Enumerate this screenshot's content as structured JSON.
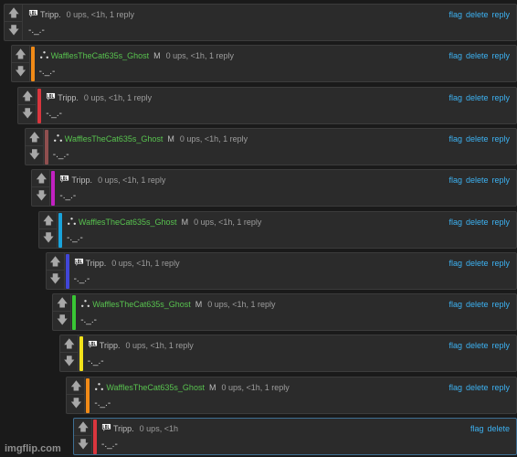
{
  "actions": {
    "flag": "flag",
    "delete": "delete",
    "reply": "reply"
  },
  "vote_icons": {
    "up": "arrow-up-icon",
    "down": "arrow-down-icon"
  },
  "colors": {
    "link": "#3db2f2",
    "green_user": "#58c34f"
  },
  "comments": [
    {
      "user": "Tripp.",
      "badge": "",
      "meta": "0 ups, <1h, 1 reply",
      "text": "-._.-",
      "bar_color": "",
      "avatar": "lol-icon",
      "actions": [
        "flag",
        "delete",
        "reply"
      ]
    },
    {
      "user": "WafflesTheCat635s_Ghost",
      "badge": "M",
      "meta": "0 ups, <1h, 1 reply",
      "text": "-._.-",
      "bar_color": "#f08a17",
      "avatar": "three-dots-icon",
      "actions": [
        "flag",
        "delete",
        "reply"
      ]
    },
    {
      "user": "Tripp.",
      "badge": "",
      "meta": "0 ups, <1h, 1 reply",
      "text": "-._.-",
      "bar_color": "#d9363e",
      "avatar": "lol-icon",
      "actions": [
        "flag",
        "delete",
        "reply"
      ]
    },
    {
      "user": "WafflesTheCat635s_Ghost",
      "badge": "M",
      "meta": "0 ups, <1h, 1 reply",
      "text": "-._.-",
      "bar_color": "#8f4f4f",
      "avatar": "three-dots-icon",
      "actions": [
        "flag",
        "delete",
        "reply"
      ]
    },
    {
      "user": "Tripp.",
      "badge": "",
      "meta": "0 ups, <1h, 1 reply",
      "text": "-._.-",
      "bar_color": "#c221c2",
      "avatar": "lol-icon",
      "actions": [
        "flag",
        "delete",
        "reply"
      ]
    },
    {
      "user": "WafflesTheCat635s_Ghost",
      "badge": "M",
      "meta": "0 ups, <1h, 1 reply",
      "text": "-._.-",
      "bar_color": "#19a3db",
      "avatar": "three-dots-icon",
      "actions": [
        "flag",
        "delete",
        "reply"
      ]
    },
    {
      "user": "Tripp.",
      "badge": "",
      "meta": "0 ups, <1h, 1 reply",
      "text": "-._.-",
      "bar_color": "#4146d8",
      "avatar": "lol-icon",
      "actions": [
        "flag",
        "delete",
        "reply"
      ]
    },
    {
      "user": "WafflesTheCat635s_Ghost",
      "badge": "M",
      "meta": "0 ups, <1h, 1 reply",
      "text": "-._.-",
      "bar_color": "#39c735",
      "avatar": "three-dots-icon",
      "actions": [
        "flag",
        "delete",
        "reply"
      ]
    },
    {
      "user": "Tripp.",
      "badge": "",
      "meta": "0 ups, <1h, 1 reply",
      "text": "-._.-",
      "bar_color": "#f2e21a",
      "avatar": "lol-icon",
      "actions": [
        "flag",
        "delete",
        "reply"
      ]
    },
    {
      "user": "WafflesTheCat635s_Ghost",
      "badge": "M",
      "meta": "0 ups, <1h, 1 reply",
      "text": "-._.-",
      "bar_color": "#f08a17",
      "avatar": "three-dots-icon",
      "actions": [
        "flag",
        "delete",
        "reply"
      ]
    },
    {
      "user": "Tripp.",
      "badge": "",
      "meta": "0 ups, <1h",
      "text": "-._.-",
      "bar_color": "#d9363e",
      "avatar": "lol-icon",
      "actions": [
        "flag",
        "delete"
      ]
    }
  ],
  "watermark": "imgflip.com"
}
